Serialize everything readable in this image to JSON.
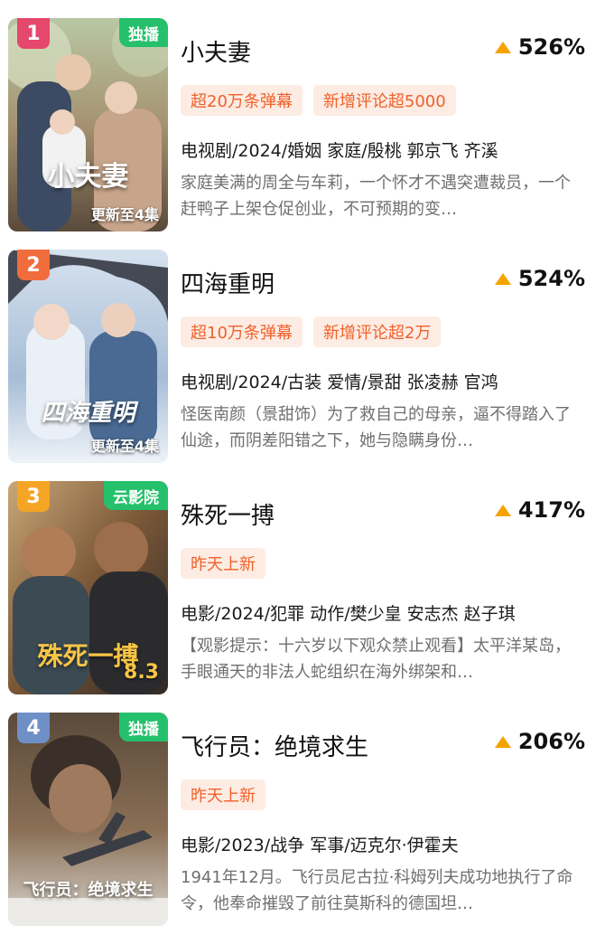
{
  "items": [
    {
      "rank": "1",
      "rank_color": "#e5476d",
      "corner_tag": "独播",
      "poster_title": "小夫妻",
      "update": "更新至4集",
      "title": "小夫妻",
      "trend": "526%",
      "badges": [
        "超20万条弹幕",
        "新增评论超5000"
      ],
      "meta": "电视剧/2024/婚姻 家庭/殷桃 郭京飞 齐溪",
      "desc": "家庭美满的周全与车莉，一个怀才不遇突遭裁员，一个赶鸭子上架仓促创业，不可预期的变…"
    },
    {
      "rank": "2",
      "rank_color": "#f26d3d",
      "corner_tag": "",
      "poster_title": "四海重明",
      "update": "更新至4集",
      "title": "四海重明",
      "trend": "524%",
      "badges": [
        "超10万条弹幕",
        "新增评论超2万"
      ],
      "meta": "电视剧/2024/古装 爱情/景甜 张凌赫 官鸿",
      "desc": "怪医南颜（景甜饰）为了救自己的母亲，逼不得踏入了仙途，而阴差阳错之下，她与隐瞒身份…"
    },
    {
      "rank": "3",
      "rank_color": "#f5a524",
      "corner_tag": "云影院",
      "poster_title": "殊死一搏",
      "poster_score": "8.3",
      "update": "",
      "title": "殊死一搏",
      "trend": "417%",
      "badges": [
        "昨天上新"
      ],
      "meta": "电影/2024/犯罪 动作/樊少皇 安志杰 赵子琪",
      "desc": "【观影提示：十六岁以下观众禁止观看】太平洋某岛，手眼通天的非法人蛇组织在海外绑架和…"
    },
    {
      "rank": "4",
      "rank_color": "#6f8fc7",
      "corner_tag": "独播",
      "poster_title": "飞行员：绝境求生",
      "update": "",
      "title": "飞行员：绝境求生",
      "trend": "206%",
      "badges": [
        "昨天上新"
      ],
      "meta": "电影/2023/战争 军事/迈克尔·伊霍夫",
      "desc": "1941年12月。飞行员尼古拉·科姆列夫成功地执行了命令，他奉命摧毁了前往莫斯科的德国坦…"
    }
  ]
}
